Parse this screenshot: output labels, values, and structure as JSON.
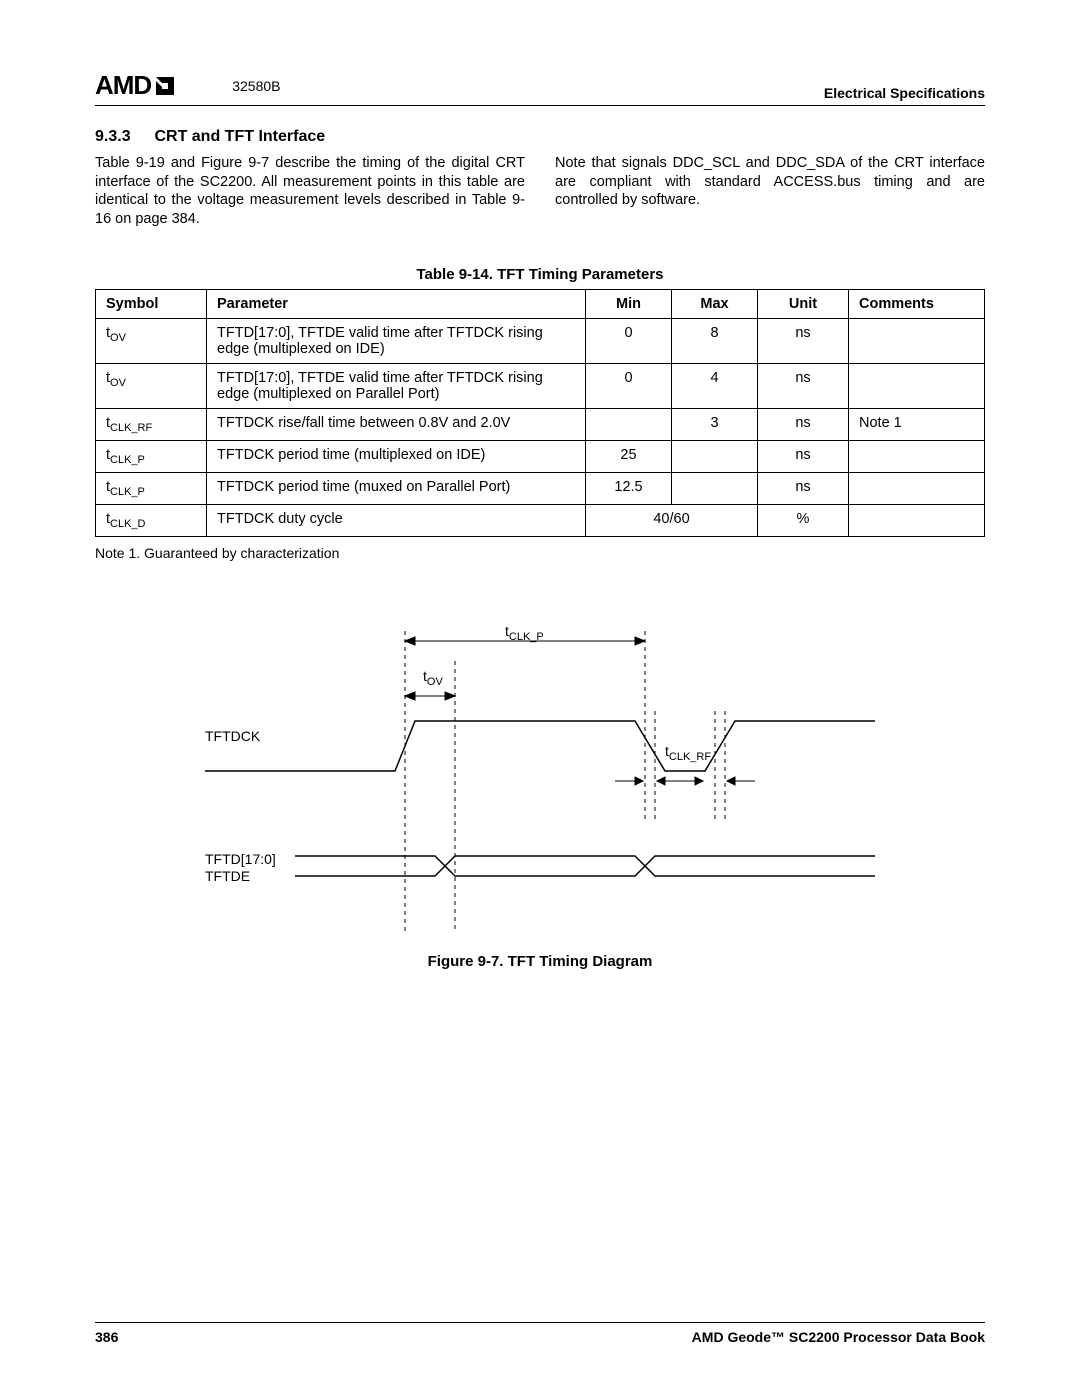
{
  "header": {
    "logo": "AMD",
    "doc_number": "32580B",
    "section_electrical": "Electrical Specifications"
  },
  "section": {
    "number": "9.3.3",
    "title": "CRT and TFT Interface"
  },
  "body": {
    "left": "Table 9-19 and Figure 9-7 describe the timing of the digital CRT interface of the SC2200. All measurement points in this table are identical to the voltage measurement levels described in Table 9-16 on page 384.",
    "right": "Note that signals DDC_SCL and DDC_SDA of the CRT interface are compliant with standard ACCESS.bus timing and are controlled by software."
  },
  "table": {
    "caption": "Table 9-14.  TFT Timing Parameters",
    "headers": [
      "Symbol",
      "Parameter",
      "Min",
      "Max",
      "Unit",
      "Comments"
    ],
    "rows": [
      {
        "sym_pre": "t",
        "sym_sub": "OV",
        "param": "TFTD[17:0], TFTDE valid time after TFTDCK rising edge (multiplexed on IDE)",
        "min": "0",
        "max": "8",
        "unit": "ns",
        "com": ""
      },
      {
        "sym_pre": "t",
        "sym_sub": "OV",
        "param": "TFTD[17:0], TFTDE valid time after TFTDCK rising edge (multiplexed on Parallel Port)",
        "min": "0",
        "max": "4",
        "unit": "ns",
        "com": ""
      },
      {
        "sym_pre": "t",
        "sym_sub": "CLK_RF",
        "param": "TFTDCK rise/fall time between 0.8V and 2.0V",
        "min": "",
        "max": "3",
        "unit": "ns",
        "com": "Note 1"
      },
      {
        "sym_pre": "t",
        "sym_sub": "CLK_P",
        "param": "TFTDCK period time (multiplexed on IDE)",
        "min": "25",
        "max": "",
        "unit": "ns",
        "com": ""
      },
      {
        "sym_pre": "t",
        "sym_sub": "CLK_P",
        "param": "TFTDCK period time (muxed on Parallel Port)",
        "min": "12.5",
        "max": "",
        "unit": "ns",
        "com": ""
      },
      {
        "sym_pre": "t",
        "sym_sub": "CLK_D",
        "param": "TFTDCK duty cycle",
        "min_max_merged": "40/60",
        "unit": "%",
        "com": ""
      }
    ],
    "note": "Note 1.   Guaranteed by characterization"
  },
  "diagram": {
    "labels": {
      "tclk_p_pre": "t",
      "tclk_p_sub": "CLK_P",
      "tov_pre": "t",
      "tov_sub": "OV",
      "tclk_rf_pre": "t",
      "tclk_rf_sub": "CLK_RF",
      "tftdck": "TFTDCK",
      "tftd": "TFTD[17:0]",
      "tftde": "TFTDE"
    },
    "caption": "Figure 9-7.  TFT Timing Diagram"
  },
  "footer": {
    "page": "386",
    "title": "AMD Geode™ SC2200  Processor Data Book"
  }
}
